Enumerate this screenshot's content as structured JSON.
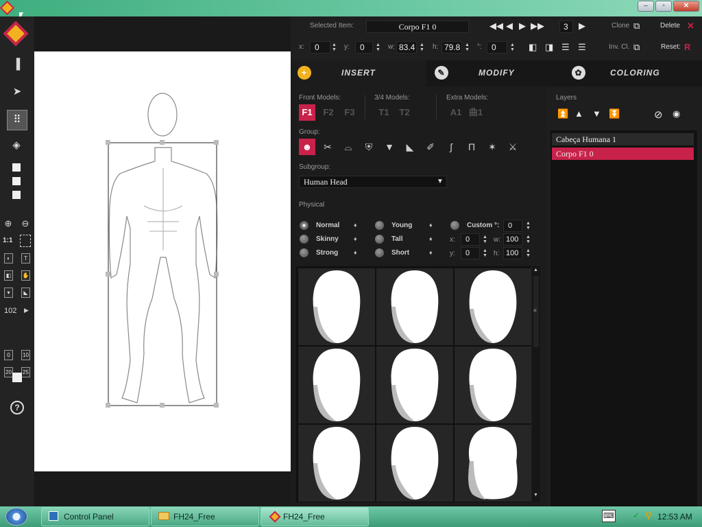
{
  "window": {
    "app_icon": "fh24-logo-icon",
    "controls": [
      "minimize-icon",
      "maximize-icon",
      "close-icon"
    ]
  },
  "toolbar": {
    "selected_item_label": "Selected Item:",
    "selected_item_value": "Corpo F1 0",
    "frame_value": "3",
    "clone_label": "Clone",
    "delete_label": "Delete",
    "inv_cl_label": "Inv. Cl.",
    "reset_label": "Reset:",
    "x_label": "x:",
    "x_value": "0",
    "y_label": "y:",
    "y_value": "0",
    "w_label": "w:",
    "w_value": "83.4",
    "h_label": "h:",
    "h_value": "79.8",
    "rot_label": "°:",
    "rot_value": "0"
  },
  "tabs": [
    {
      "label": "INSERT",
      "icon": "plus-icon"
    },
    {
      "label": "MODIFY",
      "icon": "pencil-icon"
    },
    {
      "label": "COLORING",
      "icon": "palette-icon"
    }
  ],
  "insert": {
    "front_models_label": "Front Models:",
    "front_models": [
      "F1",
      "F2",
      "F3"
    ],
    "three_quarter_label": "3/4 Models:",
    "three_quarter_models": [
      "T1",
      "T2"
    ],
    "extra_models_label": "Extra Models:",
    "extra_models": [
      "A1",
      "曲1"
    ],
    "group_label": "Group:",
    "groups": [
      "head-icon",
      "scissors-icon",
      "hat-icon",
      "armor-icon",
      "shirt-icon",
      "arm-icon",
      "brush-icon",
      "leg-icon",
      "pants-icon",
      "accessories-icon",
      "swords-icon"
    ],
    "subgroup_label": "Subgroup:",
    "subgroup_value": "Human Head",
    "physical_label": "Physical",
    "physical": [
      {
        "label": "Normal",
        "selected": true
      },
      {
        "label": "Young",
        "selected": false
      },
      {
        "label": "Custom °:",
        "selected": false
      },
      {
        "label": "Skinny",
        "selected": false
      },
      {
        "label": "Tall",
        "selected": false
      },
      {
        "label": "Strong",
        "selected": false
      },
      {
        "label": "Short",
        "selected": false
      }
    ],
    "custom": {
      "angle": "0",
      "x_label": "x:",
      "x": "0",
      "w_label": "w:",
      "w": "100",
      "y_label": "y:",
      "y": "0",
      "h_label": "h:",
      "h": "100"
    }
  },
  "layers": {
    "title": "Layers",
    "items": [
      {
        "label": "Cabeça Humana 1",
        "selected": false
      },
      {
        "label": "Corpo F1 0",
        "selected": true
      }
    ]
  },
  "leftbar": {
    "zoom_value": "102",
    "ratio_label": "1:1",
    "grid_sizes": [
      "0",
      "10",
      "20",
      "25"
    ]
  },
  "taskbar": {
    "start_icon": "windows-start-icon",
    "items": [
      {
        "label": "Control Panel",
        "active": false
      },
      {
        "label": "FH24_Free",
        "active": false
      },
      {
        "label": "FH24_Free",
        "active": true
      }
    ],
    "clock": "12:53 AM"
  },
  "colors": {
    "accent": "#c8224a",
    "insert_icon": "#f2b21f",
    "selection": "#c8224a"
  }
}
